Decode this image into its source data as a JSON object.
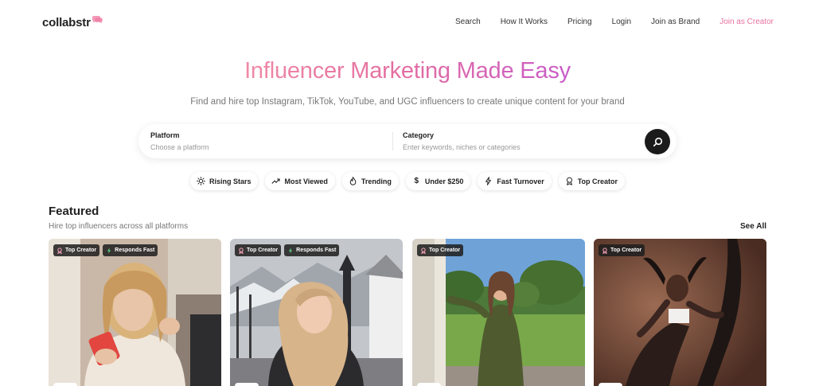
{
  "brand": {
    "name": "collabstr"
  },
  "nav": {
    "links": [
      "Search",
      "How It Works",
      "Pricing",
      "Login",
      "Join as Brand",
      "Join as Creator"
    ]
  },
  "hero": {
    "title": "Influencer Marketing Made Easy",
    "subtitle": "Find and hire top Instagram, TikTok, YouTube, and UGC influencers to create unique content for your brand"
  },
  "search": {
    "platform_label": "Platform",
    "platform_placeholder": "Choose a platform",
    "category_label": "Category",
    "category_placeholder": "Enter keywords, niches or categories",
    "button_icon": "search-icon"
  },
  "chips": [
    {
      "label": "Rising Stars",
      "icon": "sun-icon"
    },
    {
      "label": "Most Viewed",
      "icon": "trend-up-icon"
    },
    {
      "label": "Trending",
      "icon": "flame-icon"
    },
    {
      "label": "Under $250",
      "icon": "dollar-icon"
    },
    {
      "label": "Fast Turnover",
      "icon": "bolt-icon"
    },
    {
      "label": "Top Creator",
      "icon": "award-icon"
    }
  ],
  "featured": {
    "title": "Featured",
    "subtitle": "Hire top influencers across all platforms",
    "see_all": "See All"
  },
  "cards": [
    {
      "badges": [
        "Top Creator",
        "Responds Fast"
      ]
    },
    {
      "badges": [
        "Top Creator",
        "Responds Fast"
      ]
    },
    {
      "badges": [
        "Top Creator"
      ]
    },
    {
      "badges": [
        "Top Creator"
      ]
    }
  ],
  "colors": {
    "accent_pink": "#e6739f",
    "gradient_start": "#ef8aa6",
    "gradient_end": "#c85bc8",
    "badge_bg": "#1e1e1e",
    "search_button": "#1b1b1b"
  }
}
